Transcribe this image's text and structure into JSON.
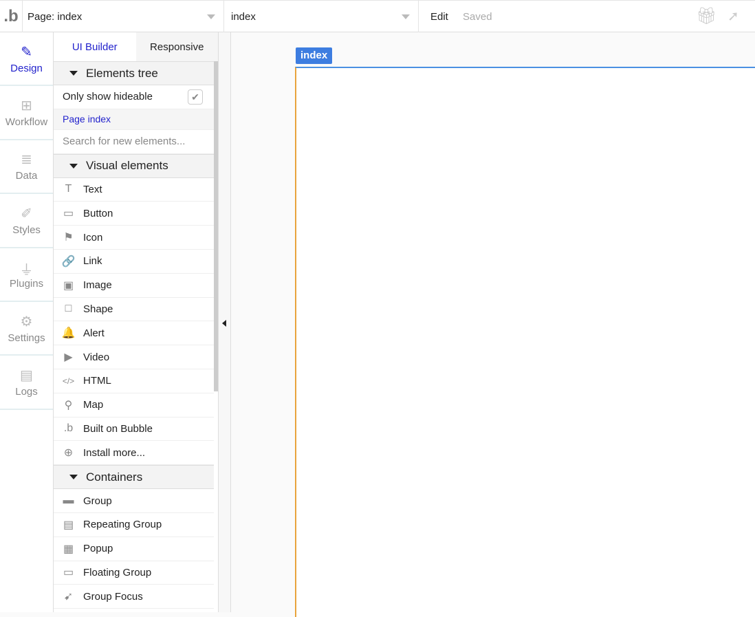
{
  "topbar": {
    "logo": ".b",
    "page_select": "Page: index",
    "view_select": "index",
    "edit": "Edit",
    "status": "Saved"
  },
  "nav": [
    {
      "label": "Design",
      "icon": "✎"
    },
    {
      "label": "Workflow",
      "icon": "⊞"
    },
    {
      "label": "Data",
      "icon": "≣"
    },
    {
      "label": "Styles",
      "icon": "✐"
    },
    {
      "label": "Plugins",
      "icon": "⏚"
    },
    {
      "label": "Settings",
      "icon": "⚙"
    },
    {
      "label": "Logs",
      "icon": "▤"
    }
  ],
  "panel": {
    "tabs": [
      "UI Builder",
      "Responsive"
    ],
    "elements_tree": "Elements tree",
    "only_hideable": "Only show hideable",
    "page_index": "Page index",
    "search_placeholder": "Search for new elements...",
    "visual_header": "Visual elements",
    "visual": [
      {
        "label": "Text",
        "icon": "T"
      },
      {
        "label": "Button",
        "icon": "▭"
      },
      {
        "label": "Icon",
        "icon": "⚑"
      },
      {
        "label": "Link",
        "icon": "🔗"
      },
      {
        "label": "Image",
        "icon": "▣"
      },
      {
        "label": "Shape",
        "icon": "□"
      },
      {
        "label": "Alert",
        "icon": "🔔"
      },
      {
        "label": "Video",
        "icon": "▶"
      },
      {
        "label": "HTML",
        "icon": "</>"
      },
      {
        "label": "Map",
        "icon": "⚲"
      },
      {
        "label": "Built on Bubble",
        "icon": ".b"
      },
      {
        "label": "Install more...",
        "icon": "⊕"
      }
    ],
    "containers_header": "Containers",
    "containers": [
      {
        "label": "Group",
        "icon": "▬"
      },
      {
        "label": "Repeating Group",
        "icon": "▤"
      },
      {
        "label": "Popup",
        "icon": "▦"
      },
      {
        "label": "Floating Group",
        "icon": "▭"
      },
      {
        "label": "Group Focus",
        "icon": "➹"
      }
    ]
  },
  "canvas": {
    "page_tag": "index"
  }
}
